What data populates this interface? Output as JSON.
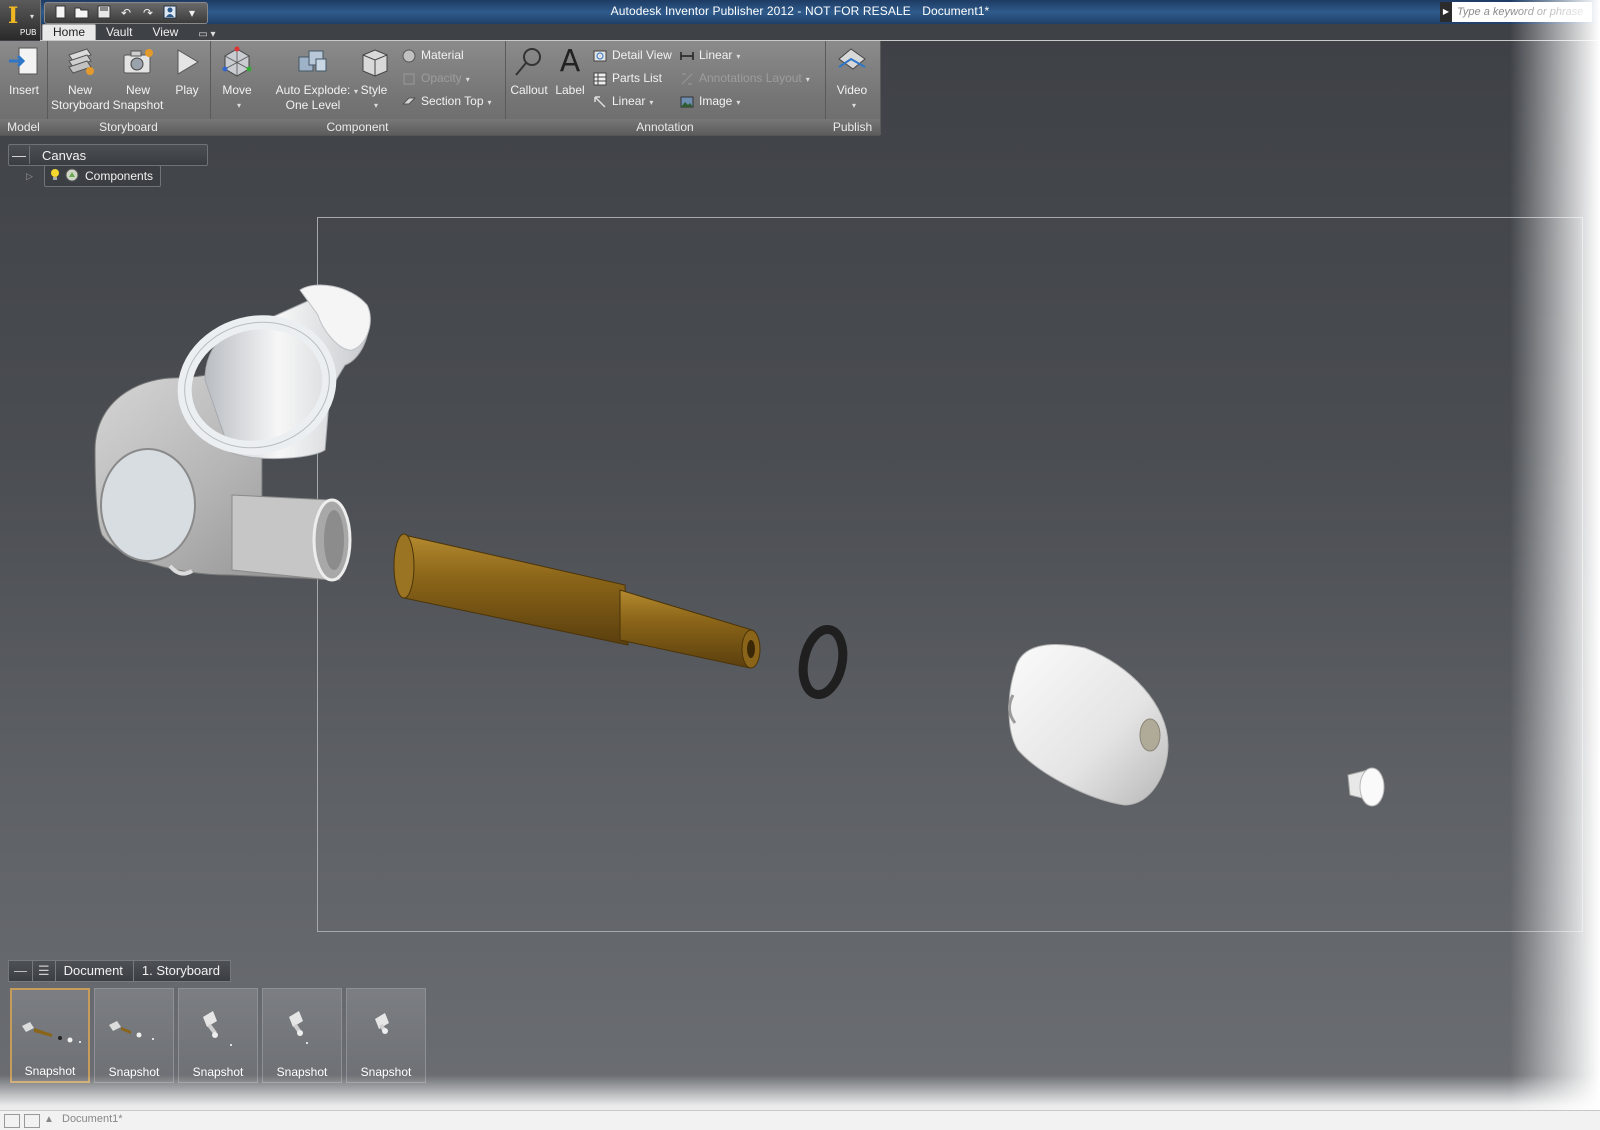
{
  "title_bar": {
    "app_title": "Autodesk Inventor Publisher 2012 - NOT FOR RESALE",
    "document": "Document1*",
    "search_placeholder": "Type a keyword or phrase",
    "app_badge": "PUB"
  },
  "quick_access": {
    "icons": [
      "new-icon",
      "open-icon",
      "save-icon",
      "undo-icon",
      "redo-icon",
      "user-icon",
      "chevron-down-icon"
    ]
  },
  "tabs": [
    {
      "label": "Home",
      "active": true
    },
    {
      "label": "Vault",
      "active": false
    },
    {
      "label": "View",
      "active": false
    }
  ],
  "ribbon": {
    "model": {
      "label": "Model",
      "insert": "Insert"
    },
    "storyboard": {
      "label": "Storyboard",
      "new_storyboard_1": "New",
      "new_storyboard_2": "Storyboard",
      "new_snapshot_1": "New",
      "new_snapshot_2": "Snapshot",
      "play": "Play"
    },
    "component": {
      "label": "Component",
      "move": "Move",
      "auto_explode_1": "Auto Explode:",
      "auto_explode_2": "One Level",
      "style": "Style",
      "material": "Material",
      "opacity": "Opacity",
      "section_top": "Section Top"
    },
    "annotation": {
      "label": "Annotation",
      "callout": "Callout",
      "label_btn": "Label",
      "detail_view": "Detail View",
      "parts_list": "Parts List",
      "linear_left": "Linear",
      "linear_right": "Linear",
      "annotations_layout": "Annotations Layout",
      "image": "Image"
    },
    "publish": {
      "label": "Publish",
      "video": "Video"
    }
  },
  "model_tree": {
    "title": "Canvas",
    "node": "Components"
  },
  "storyboard": {
    "breadcrumbs": [
      "Document",
      "1. Storyboard"
    ],
    "snapshots": [
      {
        "label": "Snapshot",
        "selected": true
      },
      {
        "label": "Snapshot",
        "selected": false
      },
      {
        "label": "Snapshot",
        "selected": false
      },
      {
        "label": "Snapshot",
        "selected": false
      },
      {
        "label": "Snapshot",
        "selected": false
      }
    ]
  },
  "status": {
    "doc_tab": "Document1*"
  },
  "colors": {
    "ribbon": "#7a7a7a",
    "canvas_top": "#3d4045",
    "canvas_bottom": "#6c6f73",
    "brass": "#8a6418",
    "selection_gold": "#c59c5a"
  }
}
